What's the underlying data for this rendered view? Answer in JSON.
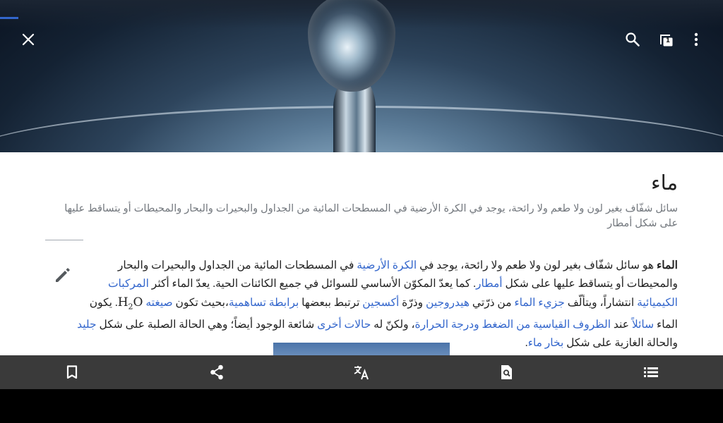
{
  "header": {
    "close_icon": "close-icon",
    "search_icon": "search-icon",
    "tabs_count": "1",
    "menu_icon": "more-vert-icon",
    "progress_color": "#3366cc"
  },
  "article": {
    "title": "ماء",
    "description": "سائل شفّاف بغير لون ولا طعم ولا رائحة، يوجد في الكرة الأرضية في المسطحات المائية من الجداول والبحيرات والبحار والمحيطات أو يتساقط عليها على شكل أمطار",
    "body": {
      "s1_bold": "الماء",
      "s1_a": " هو سائل شفّاف بغير لون ولا طعم ولا رائحة، يوجد في ",
      "link_earth": "الكرة الأرضية",
      "s1_b": " في المسطحات المائية من الجداول والبحيرات والبحار والمحيطات أو يتساقط عليها على شكل ",
      "link_rain": "أمطار",
      "s2_a": ". كما يعدّ المكوّن الأساسي للسوائل في جميع الكائنات الحية. يعدّ الماء أكثر ",
      "link_compounds": "المركبات الكيميائية",
      "s2_b": " انتشاراً، ويتألّف ",
      "link_molecule": "جزيء الماء",
      "s3_a": " من ذرّتي ",
      "link_hydrogen": "هيدروجين",
      "s3_b": " وذرّة ",
      "link_oxygen": "أكسجين",
      "s3_c": " ترتبط ببعضها ",
      "link_covalent": "برابطة تساهمية",
      "s3_d": "،بحيث تكون ",
      "link_formula": "صيغته",
      "formula_h": "H",
      "formula_sub": "2",
      "formula_o": "O",
      "s3_e": ". يكون الماء ",
      "link_liquid": "سائلاً",
      "s3_f": " عند ",
      "link_stp": "الظروف القياسية من الضغط ودرجة الحرارة",
      "s4_a": "، ولكنّ له ",
      "link_states": "حالات أخرى",
      "s4_b": " شائعة الوجود أيضاً؛ وهي الحالة الصلبة على شكل ",
      "link_ice": "جليد",
      "s4_c": " والحالة الغازية على شكل ",
      "link_vapor": "بخار ماء",
      "s4_d": "."
    },
    "link_color": "#3366cc"
  },
  "toolbar": {
    "items": [
      {
        "icon": "bookmark-icon"
      },
      {
        "icon": "share-icon"
      },
      {
        "icon": "translate-icon"
      },
      {
        "icon": "find-in-page-icon"
      },
      {
        "icon": "table-of-contents-icon"
      }
    ],
    "background": "#3a3a3a"
  }
}
